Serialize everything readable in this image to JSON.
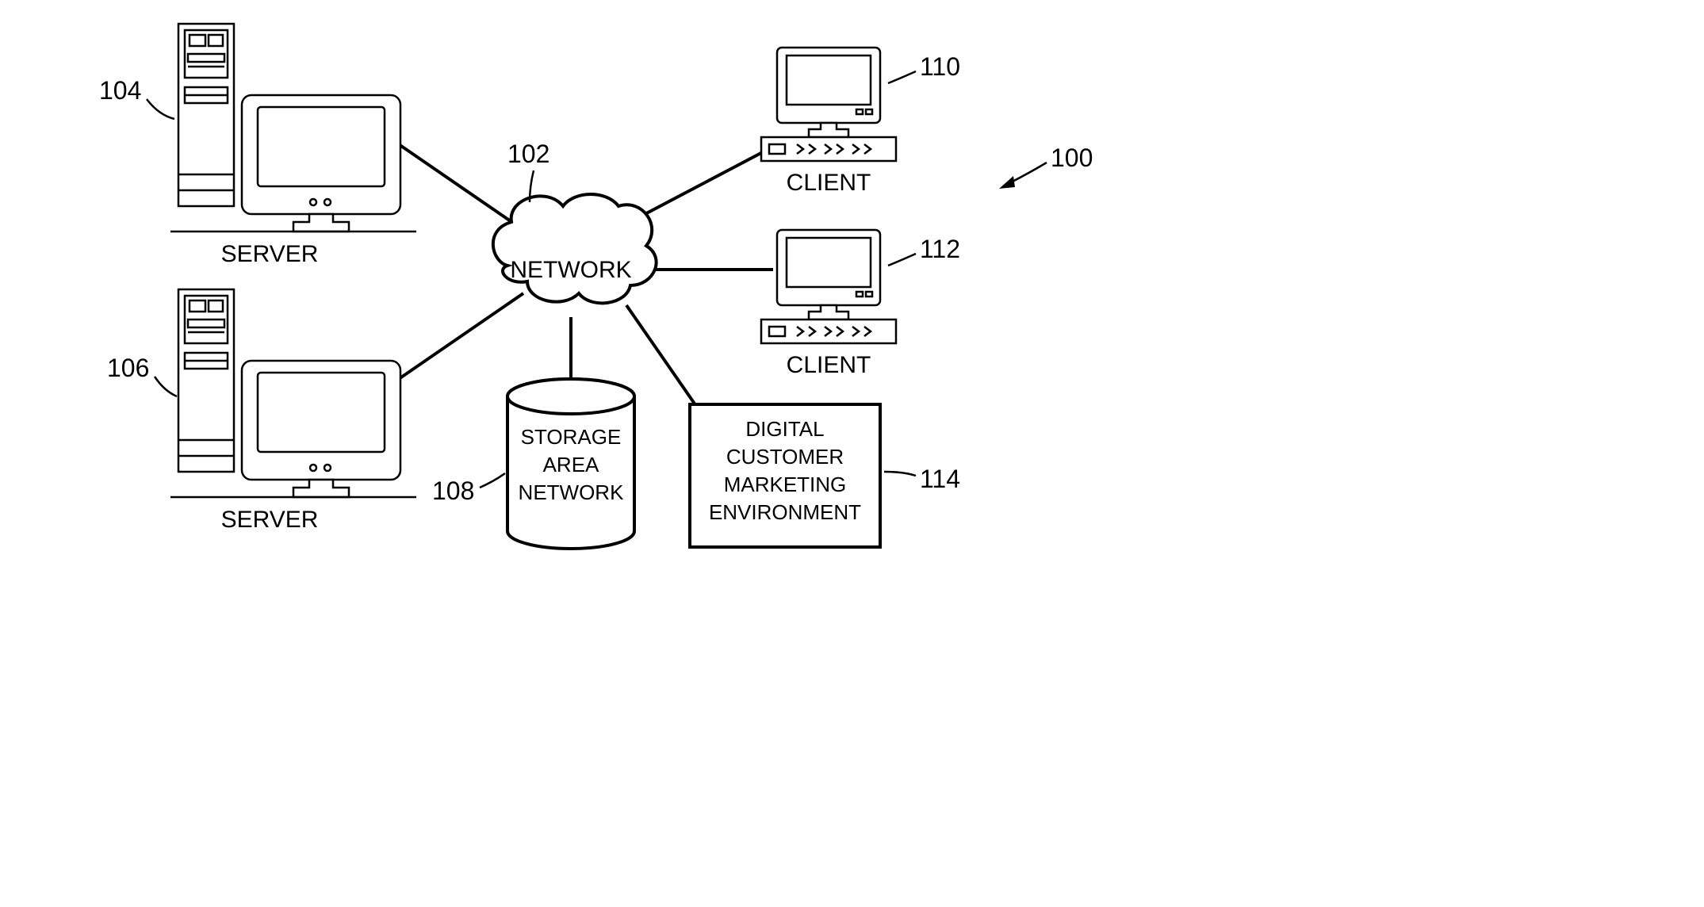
{
  "diagram": {
    "title_ref": "100",
    "nodes": {
      "network": {
        "ref": "102",
        "label": "NETWORK"
      },
      "server1": {
        "ref": "104",
        "label": "SERVER"
      },
      "server2": {
        "ref": "106",
        "label": "SERVER"
      },
      "storage": {
        "ref": "108",
        "label_line1": "STORAGE",
        "label_line2": "AREA",
        "label_line3": "NETWORK"
      },
      "client1": {
        "ref": "110",
        "label": "CLIENT"
      },
      "client2": {
        "ref": "112",
        "label": "CLIENT"
      },
      "marketing": {
        "ref": "114",
        "label_line1": "DIGITAL",
        "label_line2": "CUSTOMER",
        "label_line3": "MARKETING",
        "label_line4": "ENVIRONMENT"
      }
    }
  }
}
